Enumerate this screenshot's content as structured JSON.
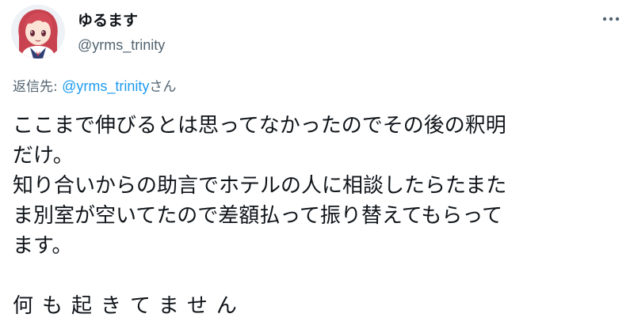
{
  "author": {
    "display_name": "ゆるます",
    "handle": "@yrms_trinity"
  },
  "icons": {
    "more": "more-horizontal-icon",
    "avatar": "anime-avatar"
  },
  "reply": {
    "prefix": "返信先: ",
    "handle": "@yrms_trinity",
    "suffix": "さん"
  },
  "tweet": {
    "lines": [
      "ここまで伸びるとは思ってなかったのでその後の釈明",
      "だけ。",
      "知り合いからの助言でホテルの人に相談したらたまた",
      "ま別室が空いてたので差額払って振り替えてもらって",
      "ます。",
      "",
      "何も起きてません"
    ]
  },
  "colors": {
    "text": "#0f1419",
    "secondary": "#536471",
    "link": "#1d9bf0"
  }
}
